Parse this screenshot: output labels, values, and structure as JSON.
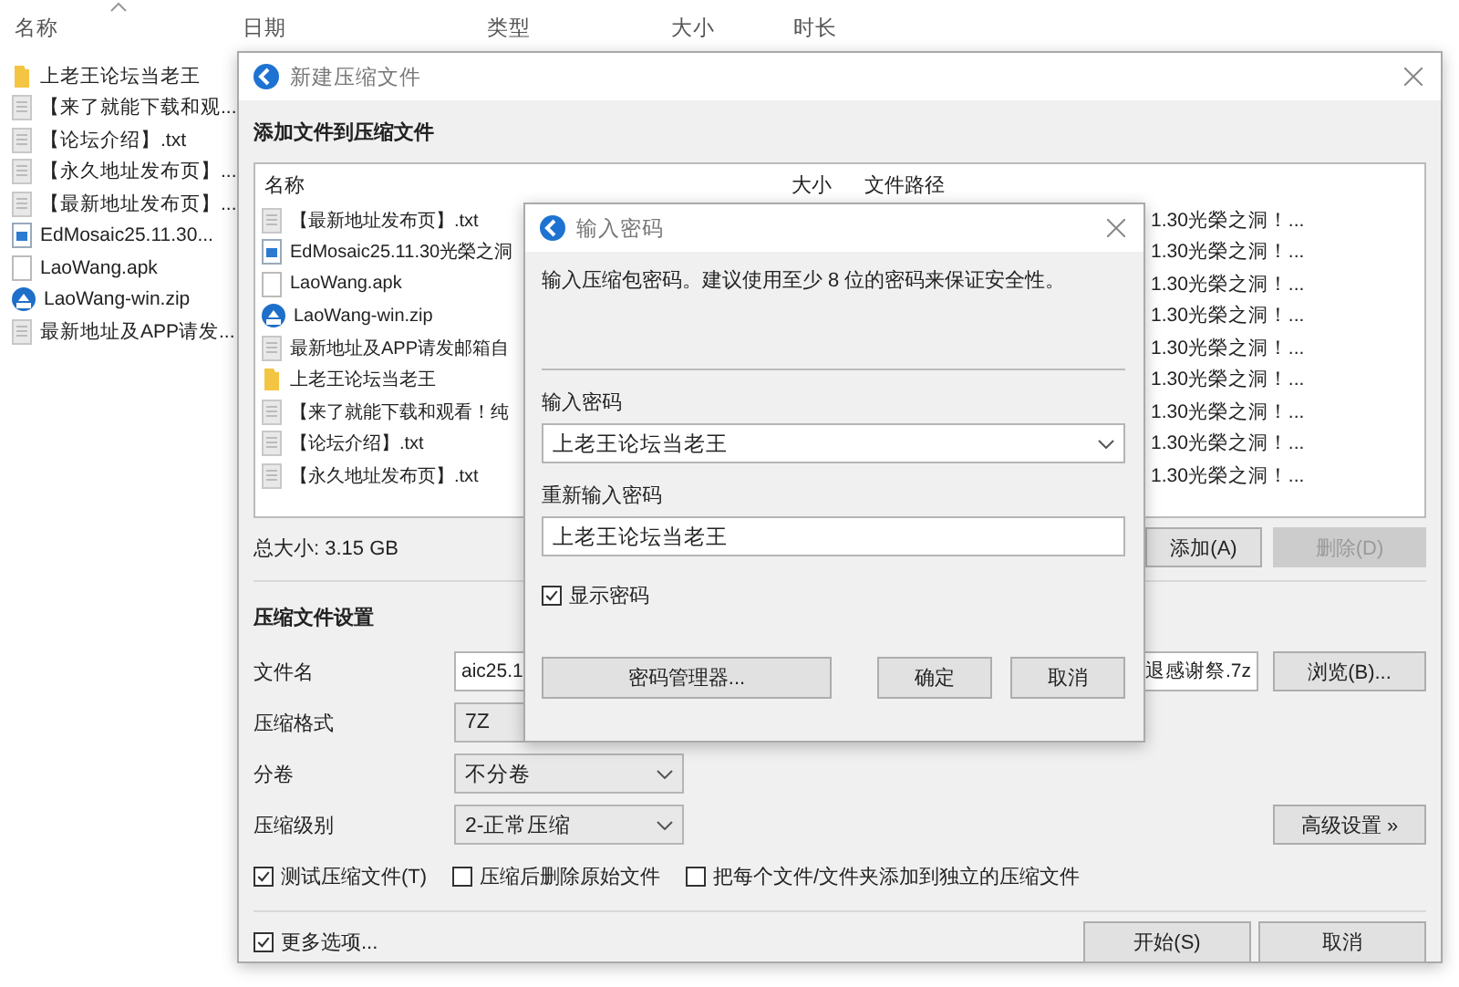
{
  "explorer": {
    "columns": [
      "名称",
      "日期",
      "类型",
      "大小",
      "时长"
    ],
    "items": [
      {
        "name": "上老王论坛当老王",
        "kind": "folder"
      },
      {
        "name": "【来了就能下载和观...",
        "kind": "text"
      },
      {
        "name": "【论坛介绍】.txt",
        "kind": "text"
      },
      {
        "name": "【永久地址发布页】...",
        "kind": "text"
      },
      {
        "name": "【最新地址发布页】...",
        "kind": "text"
      },
      {
        "name": "EdMosaic25.11.30...",
        "kind": "image"
      },
      {
        "name": "LaoWang.apk",
        "kind": "blank"
      },
      {
        "name": "LaoWang-win.zip",
        "kind": "zip"
      },
      {
        "name": "最新地址及APP请发...",
        "kind": "text"
      }
    ]
  },
  "archive_dialog": {
    "title": "新建压缩文件",
    "files_heading": "添加文件到压缩文件",
    "file_list": {
      "columns": [
        "名称",
        "大小",
        "文件路径"
      ],
      "rows": [
        {
          "name": "【最新地址发布页】.txt",
          "kind": "text",
          "path": "1.30光榮之洞！..."
        },
        {
          "name": "EdMosaic25.11.30光榮之洞",
          "kind": "image",
          "path": "1.30光榮之洞！..."
        },
        {
          "name": "LaoWang.apk",
          "kind": "blank",
          "path": "1.30光榮之洞！..."
        },
        {
          "name": "LaoWang-win.zip",
          "kind": "zip",
          "path": "1.30光榮之洞！..."
        },
        {
          "name": "最新地址及APP请发邮箱自",
          "kind": "text",
          "path": "1.30光榮之洞！..."
        },
        {
          "name": "上老王论坛当老王",
          "kind": "folder",
          "path": "1.30光榮之洞！..."
        },
        {
          "name": "【来了就能下载和观看！纯",
          "kind": "text",
          "path": "1.30光榮之洞！..."
        },
        {
          "name": "【论坛介绍】.txt",
          "kind": "text",
          "path": "1.30光榮之洞！..."
        },
        {
          "name": "【永久地址发布页】.txt",
          "kind": "text",
          "path": "1.30光榮之洞！..."
        }
      ]
    },
    "total_size": "总大小: 3.15 GB",
    "add_button": {
      "label": "添加(A)",
      "disabled": false
    },
    "delete_button": {
      "label": "删除(D)",
      "disabled": true
    },
    "settings_heading": "压缩文件设置",
    "settings": [
      {
        "label": "文件名",
        "kind": "file",
        "value": "aic25.1",
        "value_end": "退感谢祭.7z",
        "button": "浏览(B)..."
      },
      {
        "label": "压缩格式",
        "kind": "field",
        "value": "7Z"
      },
      {
        "label": "分卷",
        "kind": "combo",
        "value": "不分卷"
      },
      {
        "label": "压缩级别",
        "kind": "combo",
        "value": "2-正常压缩",
        "button": "高级设置 »"
      }
    ],
    "options": [
      {
        "label": "测试压缩文件(T)",
        "checked": true
      },
      {
        "label": "压缩后删除原始文件",
        "checked": false
      },
      {
        "label": "把每个文件/文件夹添加到独立的压缩文件",
        "checked": false
      }
    ],
    "more_options": {
      "label": "更多选项...",
      "checked": true
    },
    "buttons": [
      "开始(S)",
      "取消"
    ]
  },
  "password_dialog": {
    "title": "输入密码",
    "hint": "输入压缩包密码。建议使用至少 8 位的密码来保证安全性。",
    "password_label": "输入密码",
    "password": "上老王论坛当老王",
    "repeat_label": "重新输入密码",
    "repeat": "上老王论坛当老王",
    "show_password": {
      "label": "显示密码",
      "checked": true
    },
    "manager_button": "密码管理器...",
    "buttons": [
      "确定",
      "取消"
    ]
  }
}
